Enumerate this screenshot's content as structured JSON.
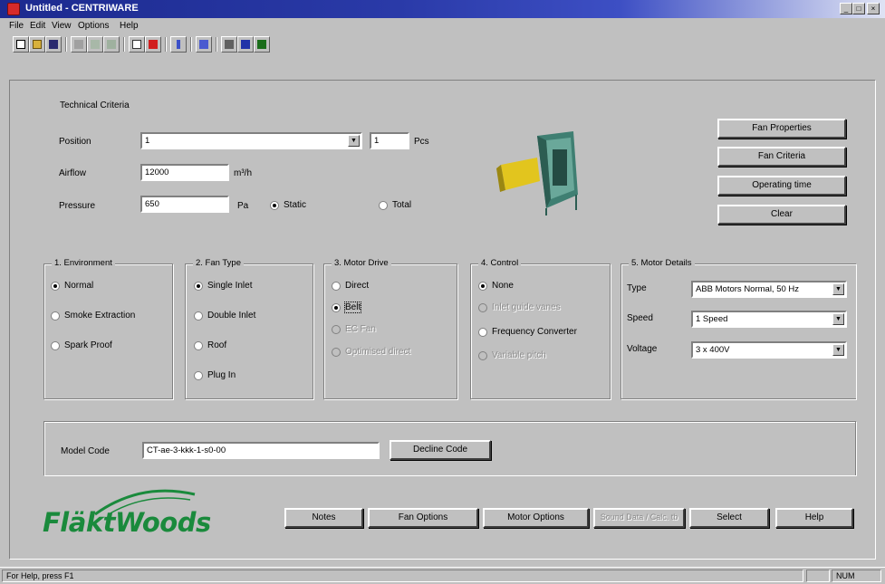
{
  "window": {
    "title": "Untitled - CENTRIWARE",
    "min": "_",
    "max": "□",
    "close": "×"
  },
  "menu": [
    "File",
    "Edit",
    "View",
    "Options",
    "Help"
  ],
  "technical": {
    "group_label": "Technical Criteria",
    "position_label": "Position",
    "position_value": "1",
    "position_qty": "1",
    "position_unit": "Pcs",
    "airflow_label": "Airflow",
    "airflow_value": "12000",
    "airflow_unit": "m³/h",
    "pressure_label": "Pressure",
    "pressure_value": "650",
    "pressure_unit": "Pa",
    "static_label": "Static",
    "total_label": "Total"
  },
  "right_buttons": [
    "Fan Properties",
    "Fan Criteria",
    "Operating time",
    "Clear"
  ],
  "environment": {
    "label": "1. Environment",
    "options": [
      "Normal",
      "Smoke Extraction",
      "Spark Proof"
    ]
  },
  "fan_type": {
    "label": "2. Fan Type",
    "options": [
      "Single Inlet",
      "Double Inlet",
      "Roof",
      "Plug In"
    ]
  },
  "motor_drive": {
    "label": "3. Motor Drive",
    "options": [
      "Direct",
      "Belt",
      "EC Fan",
      "Optimised direct"
    ]
  },
  "control": {
    "label": "4. Control",
    "options": [
      "None",
      "Inlet guide vanes",
      "Frequency Converter",
      "Variable pitch"
    ]
  },
  "motor_details": {
    "label": "5. Motor Details",
    "type_label": "Type",
    "type_value": "ABB Motors Normal, 50 Hz",
    "speed_label": "Speed",
    "speed_value": "1 Speed",
    "voltage_label": "Voltage",
    "voltage_value": "3 x 400V"
  },
  "model": {
    "label": "Model Code",
    "value": "CT-ae-3-kkk-1-s0-00",
    "button": "Decline Code"
  },
  "bottom_buttons": [
    "Notes",
    "Fan Options",
    "Motor Options",
    "Sound Data / Calc. tb",
    "Select",
    "Help"
  ],
  "logo": {
    "text": "FläktWoods"
  },
  "status": {
    "help": "For Help, press F1",
    "num": "NUM"
  },
  "colors": {
    "title_start": "#1c2a8f",
    "logo_green": "#1a8a3c",
    "face": "#c0c0c0"
  }
}
